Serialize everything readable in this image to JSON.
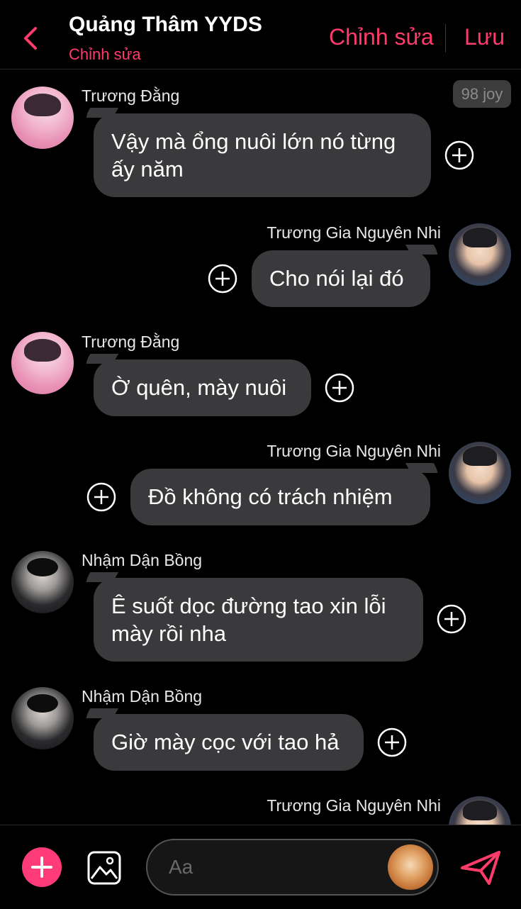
{
  "header": {
    "title": "Quảng Thâm YYDS",
    "subtitle": "Chỉnh sửa",
    "edit_label": "Chỉnh sửa",
    "save_label": "Lưu"
  },
  "badge": "98 joy",
  "messages": [
    {
      "sender": "Trương Đằng",
      "text": "Vậy mà ổng nuôi lớn nó từng ấy năm",
      "side": "left"
    },
    {
      "sender": "Trương Gia Nguyên Nhi",
      "text": "Cho nói lại đó",
      "side": "right"
    },
    {
      "sender": "Trương Đằng",
      "text": "Ờ quên, mày nuôi",
      "side": "left"
    },
    {
      "sender": "Trương Gia Nguyên Nhi",
      "text": "Đồ không có trách nhiệm",
      "side": "right"
    },
    {
      "sender": "Nhậm Dận Bồng",
      "text": "Ê suốt dọc đường tao xin lỗi mày rồi nha",
      "side": "left"
    },
    {
      "sender": "Nhậm Dận Bồng",
      "text": "Giờ mày cọc với tao hả",
      "side": "left"
    },
    {
      "sender": "Trương Gia Nguyên Nhi",
      "text": "",
      "side": "right"
    }
  ],
  "composer": {
    "placeholder": "Aa"
  },
  "colors": {
    "accent": "#ff3b6b",
    "bubble": "#3a3a3c",
    "background": "#000000"
  },
  "icons": [
    "back-chevron-icon",
    "plus-circle-icon",
    "add-icon",
    "image-icon",
    "send-icon"
  ]
}
